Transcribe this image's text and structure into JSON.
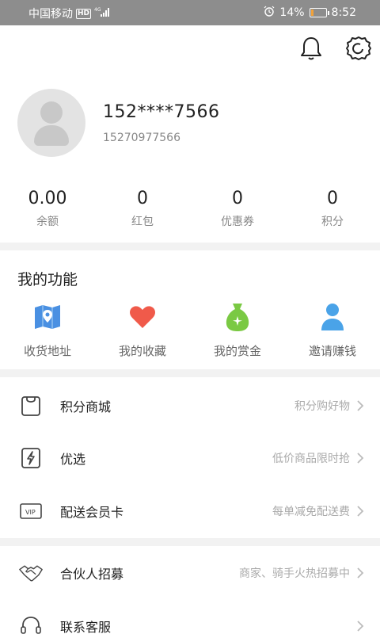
{
  "status_bar": {
    "carrier": "中国移动",
    "hd": "HD",
    "network": "4G",
    "battery": "14%",
    "battery_level": 0.14,
    "time": "8:52"
  },
  "profile": {
    "nickname": "152****7566",
    "phone": "15270977566"
  },
  "stats": [
    {
      "value": "0.00",
      "label": "余额"
    },
    {
      "value": "0",
      "label": "红包"
    },
    {
      "value": "0",
      "label": "优惠券"
    },
    {
      "value": "0",
      "label": "积分"
    }
  ],
  "functions": {
    "title": "我的功能",
    "items": [
      {
        "label": "收货地址",
        "icon": "map-pin-icon",
        "color": "#4a90e2"
      },
      {
        "label": "我的收藏",
        "icon": "heart-icon",
        "color": "#f05a4a"
      },
      {
        "label": "我的赏金",
        "icon": "money-bag-icon",
        "color": "#7ac943"
      },
      {
        "label": "邀请赚钱",
        "icon": "person-icon",
        "color": "#4aa3e8"
      }
    ]
  },
  "menu": [
    {
      "label": "积分商城",
      "desc": "积分购好物",
      "icon": "shopping-bag-icon"
    },
    {
      "label": "优选",
      "desc": "低价商品限时抢",
      "icon": "lightning-icon"
    },
    {
      "label": "配送会员卡",
      "desc": "每单减免配送费",
      "icon": "vip-card-icon"
    },
    {
      "label": "合伙人招募",
      "desc": "商家、骑手火热招募中",
      "icon": "handshake-icon"
    },
    {
      "label": "联系客服",
      "desc": "",
      "icon": "headset-icon"
    }
  ]
}
